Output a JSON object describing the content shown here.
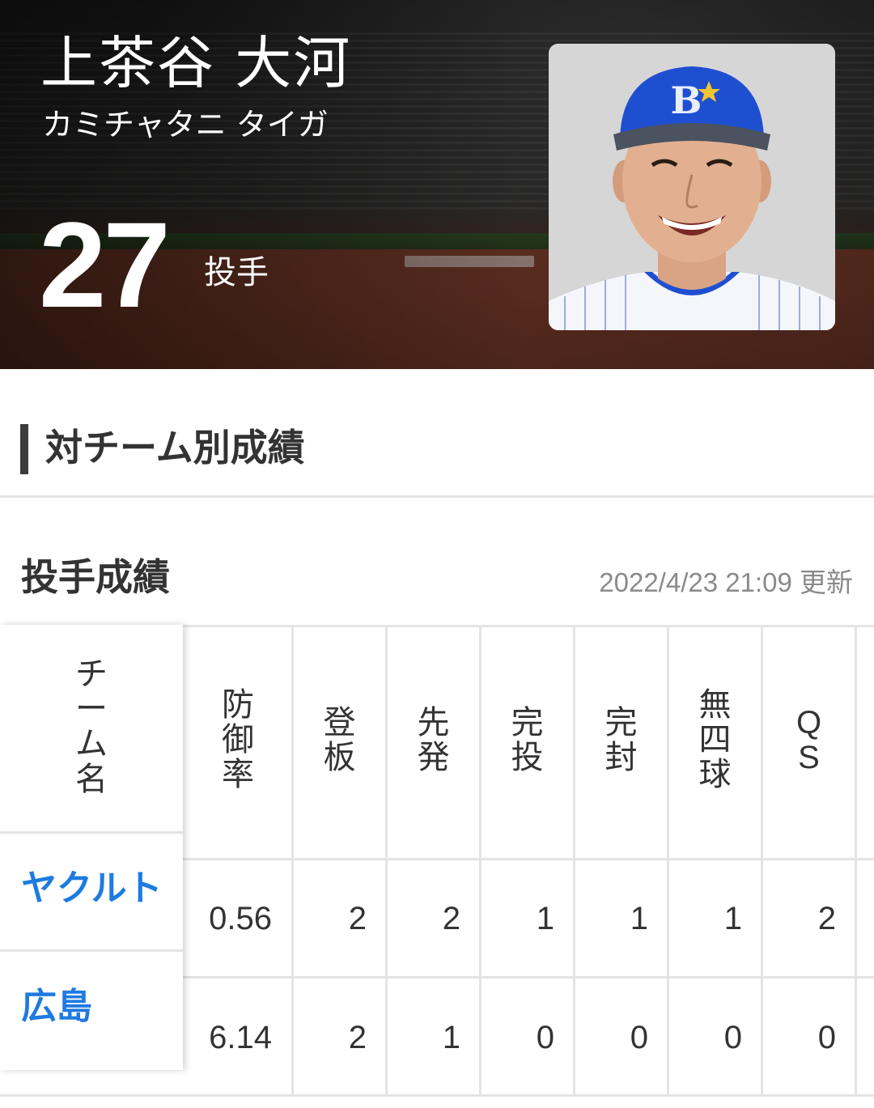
{
  "player": {
    "name": "上茶谷 大河",
    "kana": "カミチャタニ タイガ",
    "number": "27",
    "position": "投手"
  },
  "section": {
    "title": "対チーム別成績"
  },
  "stats": {
    "title": "投手成績",
    "updated": "2022/4/23 21:09 更新",
    "columns": {
      "team": [
        "チ",
        "ー",
        "ム",
        "名"
      ],
      "era": [
        "防",
        "御",
        "率"
      ],
      "games": [
        "登",
        "板"
      ],
      "starts": [
        "先",
        "発"
      ],
      "complete": [
        "完",
        "投"
      ],
      "shutout": [
        "完",
        "封"
      ],
      "no_walk": [
        "無",
        "四",
        "球"
      ],
      "qs": [
        "Q",
        "S"
      ]
    },
    "rows": [
      {
        "team": "ヤクルト",
        "era": "0.56",
        "games": "2",
        "starts": "2",
        "complete": "1",
        "shutout": "1",
        "no_walk": "1",
        "qs": "2"
      },
      {
        "team": "広島",
        "era": "6.14",
        "games": "2",
        "starts": "1",
        "complete": "0",
        "shutout": "0",
        "no_walk": "0",
        "qs": "0"
      }
    ]
  },
  "colors": {
    "link": "#1f7ae0",
    "text": "#333333",
    "muted": "#8a8a8a",
    "cap_blue": "#1f4fd1"
  }
}
